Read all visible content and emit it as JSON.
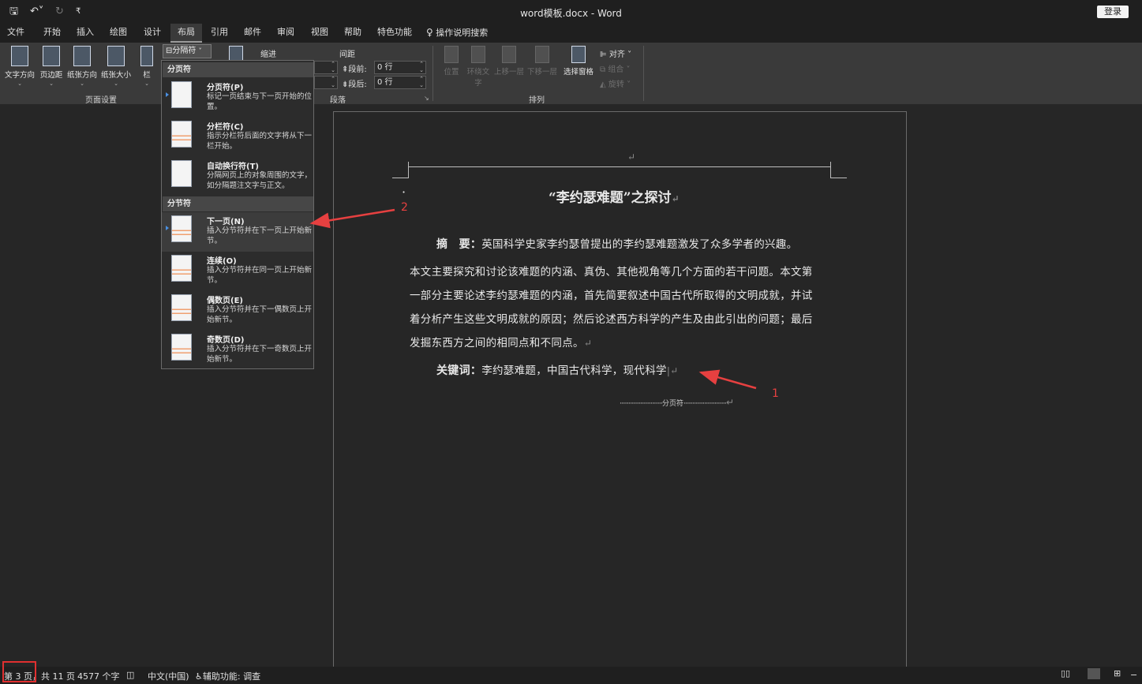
{
  "window": {
    "title": "word模板.docx  -  Word",
    "login_label": "登录"
  },
  "menu": {
    "tabs": [
      "文件",
      "开始",
      "插入",
      "绘图",
      "设计",
      "布局",
      "引用",
      "邮件",
      "审阅",
      "视图",
      "帮助",
      "特色功能"
    ],
    "active_tab": "布局",
    "search_label": "操作说明搜索"
  },
  "ribbon": {
    "page_setup": {
      "buttons": [
        "文字方向",
        "页边距",
        "纸张方向",
        "纸张大小",
        "栏"
      ],
      "label": "页面设置"
    },
    "breaks_button": "分隔符",
    "indent_label": "缩进",
    "spacing_label": "间距",
    "before_label": "段前:",
    "before_value": "0 行",
    "after_label": "段后:",
    "after_value": "0 行",
    "paragraph_label": "段落",
    "arrange": {
      "buttons": [
        "位置",
        "环绕文字",
        "上移一层",
        "下移一层",
        "选择窗格"
      ],
      "align": "对齐",
      "group": "组合",
      "rotate": "旋转",
      "label": "排列"
    }
  },
  "breaks_menu": {
    "page_breaks_header": "分页符",
    "section_breaks_header": "分节符",
    "items": [
      {
        "title": "分页符(P)",
        "desc": "标记一页结束与下一页开始的位置。"
      },
      {
        "title": "分栏符(C)",
        "desc": "指示分栏符后面的文字将从下一栏开始。"
      },
      {
        "title": "自动换行符(T)",
        "desc": "分隔网页上的对象周围的文字，如分隔题注文字与正文。"
      },
      {
        "title": "下一页(N)",
        "desc": "插入分节符并在下一页上开始新节。"
      },
      {
        "title": "连续(O)",
        "desc": "插入分节符并在同一页上开始新节。"
      },
      {
        "title": "偶数页(E)",
        "desc": "插入分节符并在下一偶数页上开始新节。"
      },
      {
        "title": "奇数页(D)",
        "desc": "插入分节符并在下一奇数页上开始新节。"
      }
    ]
  },
  "document": {
    "heading": "“李约瑟难题”之探讨",
    "abstract_label": "摘　要：",
    "abstract_lines": [
      "英国科学史家李约瑟曾提出的李约瑟难题激发了众多学者的兴趣。",
      "本文主要探究和讨论该难题的内涵、真伪、其他视角等几个方面的若干问题。本文第",
      "一部分主要论述李约瑟难题的内涵，首先简要叙述中国古代所取得的文明成就，并试",
      "着分析产生这些文明成就的原因；然后论述西方科学的产生及由此引出的问题；最后",
      "发掘东西方之间的相同点和不同点。"
    ],
    "keywords_label": "关键词：",
    "keywords": "李约瑟难题，中国古代科学，现代科学",
    "page_break_label": "分页符"
  },
  "annotations": {
    "label_1": "1",
    "label_2": "2",
    "arrow_color": "#e64040"
  },
  "status": {
    "page": "第 3 页，共 11 页",
    "words": "4577 个字",
    "language": "中文(中国)",
    "accessibility": "辅助功能: 调查"
  }
}
